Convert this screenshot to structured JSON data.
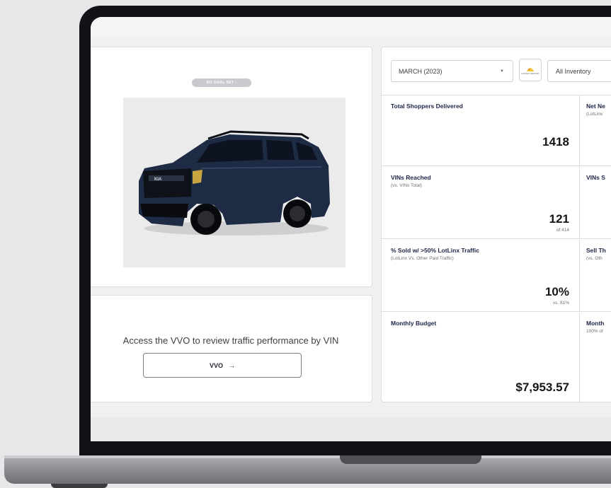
{
  "left_panel": {
    "goal_badge": "NO GOAL SET ›",
    "vvo_prompt": "Access the VVO to review traffic performance by VIN",
    "vvo_button": "VVO",
    "vvo_arrow": "→"
  },
  "toolbar": {
    "month": "MARCH (2023)",
    "report_icon_label": "CANARY REPORT",
    "inventory": "All Inventory"
  },
  "metrics": [
    {
      "left": {
        "title": "Total Shoppers Delivered",
        "subtitle": "",
        "value": "1418",
        "compare": ""
      },
      "right": {
        "title": "Net Ne",
        "subtitle": "(LotLinx"
      }
    },
    {
      "left": {
        "title": "VINs Reached",
        "subtitle": "(vs. VINs Total)",
        "value": "121",
        "compare": "of 414"
      },
      "right": {
        "title": "VINs S",
        "subtitle": ""
      }
    },
    {
      "left": {
        "title": "% Sold w/ >50% LotLinx Traffic",
        "subtitle": "(LotLinx Vs. Other Paid Traffic)",
        "value": "10%",
        "compare": "vs. 81%"
      },
      "right": {
        "title": "Sell Th",
        "subtitle": "(vs. Oth"
      }
    },
    {
      "left": {
        "title": "Monthly Budget",
        "subtitle": "",
        "value": "$7,953.57",
        "compare": ""
      },
      "right": {
        "title": "Month",
        "subtitle": "100% of"
      }
    }
  ],
  "colors": {
    "title_navy": "#1f2548",
    "car_body": "#1e2b44",
    "pill_gray": "#c8cacf"
  }
}
